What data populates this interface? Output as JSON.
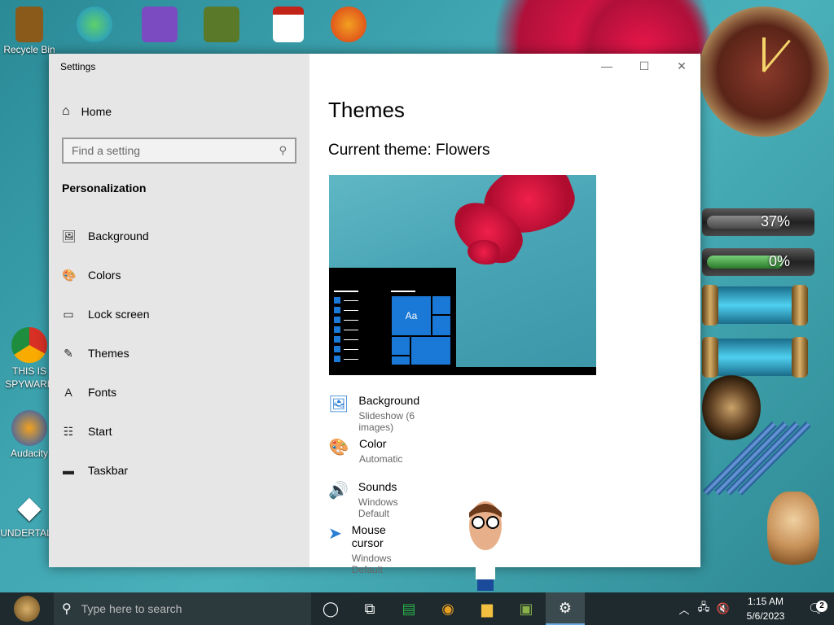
{
  "desktop": {
    "icons": [
      {
        "label": "Recycle Bin",
        "icon": "recycle-bin-icon",
        "color": "#8a5a1a"
      },
      {
        "label": "",
        "icon": "edge-icon",
        "color": "#1c8fd6"
      },
      {
        "label": "",
        "icon": "visual-studio-icon",
        "color": "#7b4bc2"
      },
      {
        "label": "",
        "icon": "minecraft-icon",
        "color": "#5a7a2a"
      },
      {
        "label": "",
        "icon": "swf-file-icon",
        "color": "#c2241a"
      },
      {
        "label": "",
        "icon": "p-app-icon",
        "color": "#d93a1a"
      },
      {
        "label": "THIS IS SPYWARE",
        "icon": "chrome-icon",
        "color": "#2a8a3a"
      },
      {
        "label": "Audacity",
        "icon": "audacity-icon",
        "color": "#1a58c2"
      },
      {
        "label": "UNDERTALE",
        "icon": "unity-icon",
        "color": "#222222"
      }
    ],
    "widgets": {
      "gauge1": {
        "value": "37%",
        "level": 0.37
      },
      "gauge2": {
        "value": "0%",
        "level": 0
      }
    }
  },
  "window": {
    "title": "Settings",
    "controls": {
      "minimize": "—",
      "maximize": "☐",
      "close": "✕"
    },
    "sidebar": {
      "home_label": "Home",
      "search_placeholder": "Find a setting",
      "section_title": "Personalization",
      "items": [
        {
          "label": "Background",
          "icon": "picture-icon",
          "glyph": "🖼"
        },
        {
          "label": "Colors",
          "icon": "palette-icon",
          "glyph": "🎨"
        },
        {
          "label": "Lock screen",
          "icon": "lock-screen-icon",
          "glyph": "▭"
        },
        {
          "label": "Themes",
          "icon": "themes-icon",
          "glyph": "✎"
        },
        {
          "label": "Fonts",
          "icon": "fonts-icon",
          "glyph": "A"
        },
        {
          "label": "Start",
          "icon": "start-icon",
          "glyph": "☷"
        },
        {
          "label": "Taskbar",
          "icon": "taskbar-icon",
          "glyph": "▬"
        }
      ]
    },
    "main": {
      "title": "Themes",
      "current_theme_label": "Current theme: Flowers",
      "preview_tile_text": "Aa",
      "options": [
        {
          "name": "Background",
          "value": "Slideshow (6 images)",
          "icon": "picture-icon",
          "glyph": "🖼"
        },
        {
          "name": "Color",
          "value": "Automatic",
          "icon": "palette-icon",
          "glyph": "🎨"
        },
        {
          "name": "Sounds",
          "value": "Windows Default",
          "icon": "speaker-icon",
          "glyph": "🔊"
        },
        {
          "name": "Mouse cursor",
          "value": "Windows Default",
          "icon": "cursor-icon",
          "glyph": "➤"
        }
      ]
    }
  },
  "taskbar": {
    "search_placeholder": "Type here to search",
    "time": "1:15 AM",
    "date": "5/6/2023",
    "notification_count": "2",
    "accent": "#1a78d6"
  }
}
